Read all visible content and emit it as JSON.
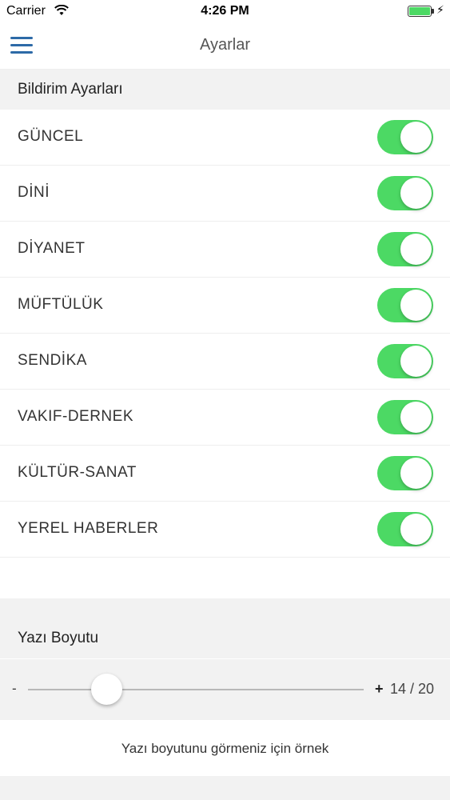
{
  "status_bar": {
    "carrier": "Carrier",
    "time": "4:26 PM",
    "battery_level": 1.0,
    "battery_color": "#4cd964"
  },
  "nav": {
    "title": "Ayarlar",
    "menu_icon": "hamburger-menu-icon",
    "accent_color": "#2d6aa7"
  },
  "notifications": {
    "header": "Bildirim Ayarları",
    "items": [
      {
        "label": "GÜNCEL",
        "enabled": true
      },
      {
        "label": "DİNİ",
        "enabled": true
      },
      {
        "label": "DİYANET",
        "enabled": true
      },
      {
        "label": "MÜFTÜLÜK",
        "enabled": true
      },
      {
        "label": "SENDİKA",
        "enabled": true
      },
      {
        "label": "VAKIF-DERNEK",
        "enabled": true
      },
      {
        "label": "KÜLTÜR-SANAT",
        "enabled": true
      },
      {
        "label": "YEREL HABERLER",
        "enabled": true
      }
    ],
    "toggle_on_color": "#4cd964"
  },
  "font_size": {
    "header": "Yazı Boyutu",
    "minus_label": "-",
    "plus_label": "+",
    "value_text": "14 / 20",
    "value": 14,
    "max": 20,
    "sample_text": "Yazı boyutunu görmeniz için örnek"
  }
}
